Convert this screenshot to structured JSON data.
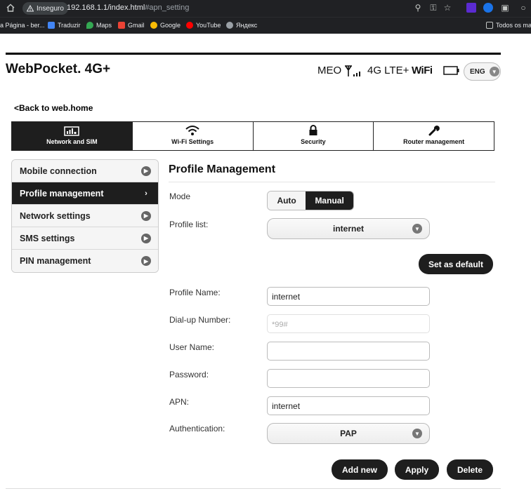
{
  "browser": {
    "security_label": "Inseguro",
    "url_main": "192.168.1.1/index.html",
    "url_hash": "#apn_setting",
    "bookmarks": [
      {
        "label": "a Página - ber..."
      },
      {
        "label": "Traduzir"
      },
      {
        "label": "Maps"
      },
      {
        "label": "Gmail"
      },
      {
        "label": "Google"
      },
      {
        "label": "YouTube"
      },
      {
        "label": "Яндекс"
      }
    ],
    "all_bookmarks": "Todos os mar"
  },
  "header": {
    "brand": "WebPocket. 4G+",
    "operator": "MEO",
    "network": "4G LTE+",
    "wifi": "WiFi",
    "language": "ENG"
  },
  "back_link": "<Back to web.home",
  "tabs": [
    {
      "label": "Network and SIM",
      "icon": "network-icon"
    },
    {
      "label": "Wi-Fi Settings",
      "icon": "wifi-icon"
    },
    {
      "label": "Security",
      "icon": "lock-icon"
    },
    {
      "label": "Router management",
      "icon": "wrench-icon"
    }
  ],
  "sidebar": {
    "items": [
      {
        "label": "Mobile connection"
      },
      {
        "label": "Profile management"
      },
      {
        "label": "Network settings"
      },
      {
        "label": "SMS settings"
      },
      {
        "label": "PIN management"
      }
    ]
  },
  "main": {
    "title": "Profile Management",
    "mode_label": "Mode",
    "mode_auto": "Auto",
    "mode_manual": "Manual",
    "profile_list_label": "Profile list:",
    "profile_list_value": "internet",
    "set_default": "Set as default",
    "profile_name_label": "Profile Name:",
    "profile_name_value": "internet",
    "dialup_label": "Dial-up Number:",
    "dialup_placeholder": "*99#",
    "username_label": "User Name:",
    "username_value": "",
    "password_label": "Password:",
    "password_value": "",
    "apn_label": "APN:",
    "apn_value": "internet",
    "auth_label": "Authentication:",
    "auth_value": "PAP",
    "add_new": "Add new",
    "apply": "Apply",
    "delete": "Delete"
  }
}
